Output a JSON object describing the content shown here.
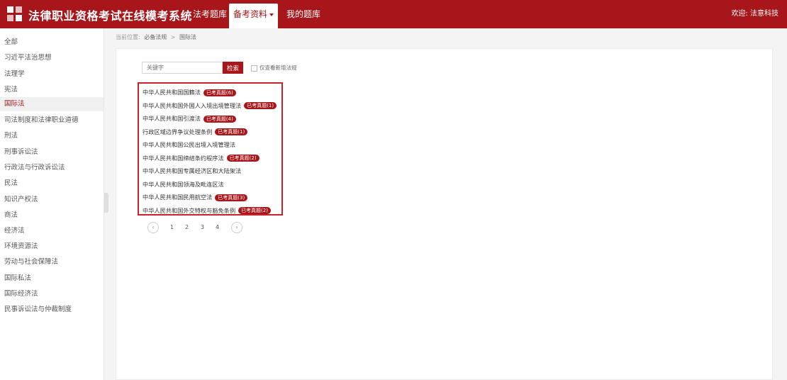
{
  "header": {
    "title": "法律职业资格考试在线模考系统",
    "nav": [
      "法考题库",
      "备考资料",
      "我的题库"
    ],
    "welcome": "欢迎: 法意科技",
    "brand_color": "#a6161a"
  },
  "sidebar": {
    "items": [
      "全部",
      "习近平法治思想",
      "法理学",
      "宪法",
      "国际法",
      "司法制度和法律职业道德",
      "刑法",
      "刑事诉讼法",
      "行政法与行政诉讼法",
      "民法",
      "知识产权法",
      "商法",
      "经济法",
      "环境资源法",
      "劳动与社会保障法",
      "国际私法",
      "国际经济法",
      "民事诉讼法与仲裁制度"
    ],
    "active": "国际法"
  },
  "breadcrumb": {
    "label": "当前位置:",
    "items": [
      "必备法规",
      "国际法"
    ]
  },
  "search": {
    "placeholder": "关键字",
    "button": "检索",
    "checkbox_label": "仅查看新增法规"
  },
  "laws": [
    {
      "name": "中华人民共和国国籍法",
      "badge": "已考真题(6)"
    },
    {
      "name": "中华人民共和国外国人入境出境管理法",
      "badge": "已考真题(1)"
    },
    {
      "name": "中华人民共和国引渡法",
      "badge": "已考真题(4)"
    },
    {
      "name": "行政区域边界争议处理条例",
      "badge": "已考真题(1)"
    },
    {
      "name": "中华人民共和国公民出境入境管理法",
      "badge": ""
    },
    {
      "name": "中华人民共和国缔结条约程序法",
      "badge": "已考真题(2)"
    },
    {
      "name": "中华人民共和国专属经济区和大陆架法",
      "badge": ""
    },
    {
      "name": "中华人民共和国领海及毗连区法",
      "badge": ""
    },
    {
      "name": "中华人民共和国民用航空法",
      "badge": "已考真题(3)"
    },
    {
      "name": "中华人民共和国外交特权与豁免条例",
      "badge": "已考真题(2)"
    }
  ],
  "pagination": {
    "prev": "‹",
    "pages": [
      "1",
      "2",
      "3",
      "4"
    ],
    "next": "›"
  }
}
